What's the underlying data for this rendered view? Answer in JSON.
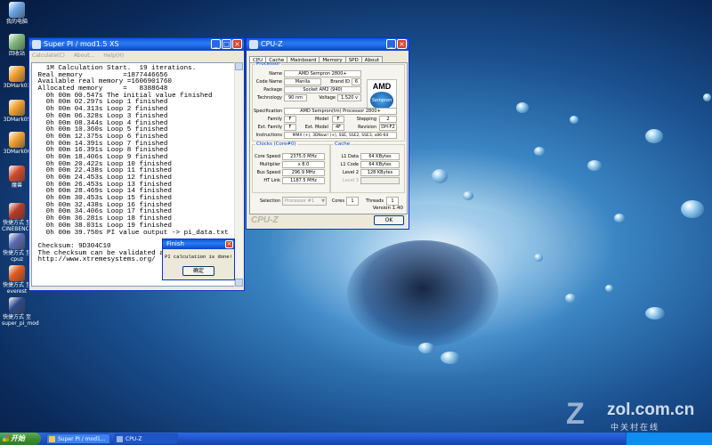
{
  "desktop": {
    "icons": [
      {
        "label": "我的电脑",
        "color": "#6aa2e0"
      },
      {
        "label": "回收站",
        "color": "#7fb87a"
      },
      {
        "label": "3DMark03",
        "color": "#f0a030"
      },
      {
        "label": "3DMark05",
        "color": "#f0a030"
      },
      {
        "label": "3DMark06",
        "color": "#f0a030"
      },
      {
        "label": "魔兽",
        "color": "#d04a2a"
      },
      {
        "label": "快捷方式 至 CINEBENCH",
        "color": "#b83a28"
      },
      {
        "label": "快捷方式 至 cpuz",
        "color": "#5a6ab0"
      },
      {
        "label": "快捷方式 至 everest",
        "color": "#e05a20"
      },
      {
        "label": "快捷方式 至 super_pi_mod",
        "color": "#304a88"
      }
    ],
    "watermark": {
      "logo_text": "zol.com.cn",
      "sub_text": "中关村在线"
    }
  },
  "superpi": {
    "title": "Super PI / mod1.5 XS",
    "menu": [
      "Calculate(C)",
      "About...",
      "Help(H)"
    ],
    "output": [
      "   1M Calculation Start.  19 iterations.",
      " Real memory          =1877446656",
      " Available real memory =1606901760",
      " Allocated memory     =   8388648",
      "   0h 00m 00.547s The initial value finished",
      "   0h 00m 02.297s Loop 1 finished",
      "   0h 00m 04.313s Loop 2 finished",
      "   0h 00m 06.328s Loop 3 finished",
      "   0h 00m 08.344s Loop 4 finished",
      "   0h 00m 10.360s Loop 5 finished",
      "   0h 00m 12.375s Loop 6 finished",
      "   0h 00m 14.391s Loop 7 finished",
      "   0h 00m 16.391s Loop 8 finished",
      "   0h 00m 18.406s Loop 9 finished",
      "   0h 00m 20.422s Loop 10 finished",
      "   0h 00m 22.438s Loop 11 finished",
      "   0h 00m 24.453s Loop 12 finished",
      "   0h 00m 26.453s Loop 13 finished",
      "   0h 00m 28.469s Loop 14 finished",
      "   0h 00m 30.453s Loop 15 finished",
      "   0h 00m 32.438s Loop 16 finished",
      "   0h 00m 34.406s Loop 17 finished",
      "   0h 00m 36.281s Loop 18 finished",
      "   0h 00m 38.031s Loop 19 finished",
      "   0h 00m 39.750s PI value output -> pi_data.txt",
      "",
      " Checksum: 9D304C10",
      " The checksum can be validated at",
      " http://www.xtremesystems.org/"
    ]
  },
  "finish_dialog": {
    "title": "Finish",
    "message": "PI calculation is done!",
    "ok_label": "确定"
  },
  "cpuz": {
    "title": "CPU-Z",
    "tabs": [
      "CPU",
      "Cache",
      "Mainboard",
      "Memory",
      "SPD",
      "About"
    ],
    "active_tab": "CPU",
    "processor": {
      "legend": "Processor",
      "name_label": "Name",
      "name": "AMD Sempron 2800+",
      "codename_label": "Code Name",
      "codename": "Manila",
      "brandid_label": "Brand ID",
      "brandid": "6",
      "package_label": "Package",
      "package": "Socket AM2 (940)",
      "technology_label": "Technology",
      "technology": "90 nm",
      "voltage_label": "Voltage",
      "voltage": "1.520 v",
      "spec_label": "Specification",
      "specification": "AMD Sempron(tm) Processor 2800+",
      "family_label": "Family",
      "family": "F",
      "model_label": "Model",
      "model": "F",
      "stepping_label": "Stepping",
      "stepping": "2",
      "extfamily_label": "Ext. Family",
      "extfamily": "F",
      "extmodel_label": "Ext. Model",
      "extmodel": "4F",
      "revision_label": "Revision",
      "revision": "DH-F2",
      "instructions_label": "Instructions",
      "instructions": "MMX (+), 3DNow! (+), SSE, SSE2, SSE3, x86-64",
      "logo_brand": "AMD",
      "logo_product": "Sempron"
    },
    "clocks": {
      "legend": "Clocks (Core#0)",
      "core_speed_label": "Core Speed",
      "core_speed": "2375.0 MHz",
      "multiplier_label": "Multiplier",
      "multiplier": "x 8.0",
      "bus_speed_label": "Bus Speed",
      "bus_speed": "296.9 MHz",
      "ht_link_label": "HT Link",
      "ht_link": "1187.5 MHz"
    },
    "cache": {
      "legend": "Cache",
      "l1data_label": "L1 Data",
      "l1data": "64 KBytes",
      "l1code_label": "L1 Code",
      "l1code": "64 KBytes",
      "level2_label": "Level 2",
      "level2": "128 KBytes",
      "level3_label": "Level 3",
      "level3": ""
    },
    "selection_label": "Selection",
    "selection_value": "Processor #1",
    "cores_label": "Cores",
    "cores": "1",
    "threads_label": "Threads",
    "threads": "1",
    "version": "Version 1.40",
    "ok_label": "OK",
    "brand_footer": "CPU-Z"
  },
  "taskbar": {
    "start_label": "开始",
    "tasks": [
      "Super PI / mod1...",
      "CPU-Z"
    ]
  }
}
